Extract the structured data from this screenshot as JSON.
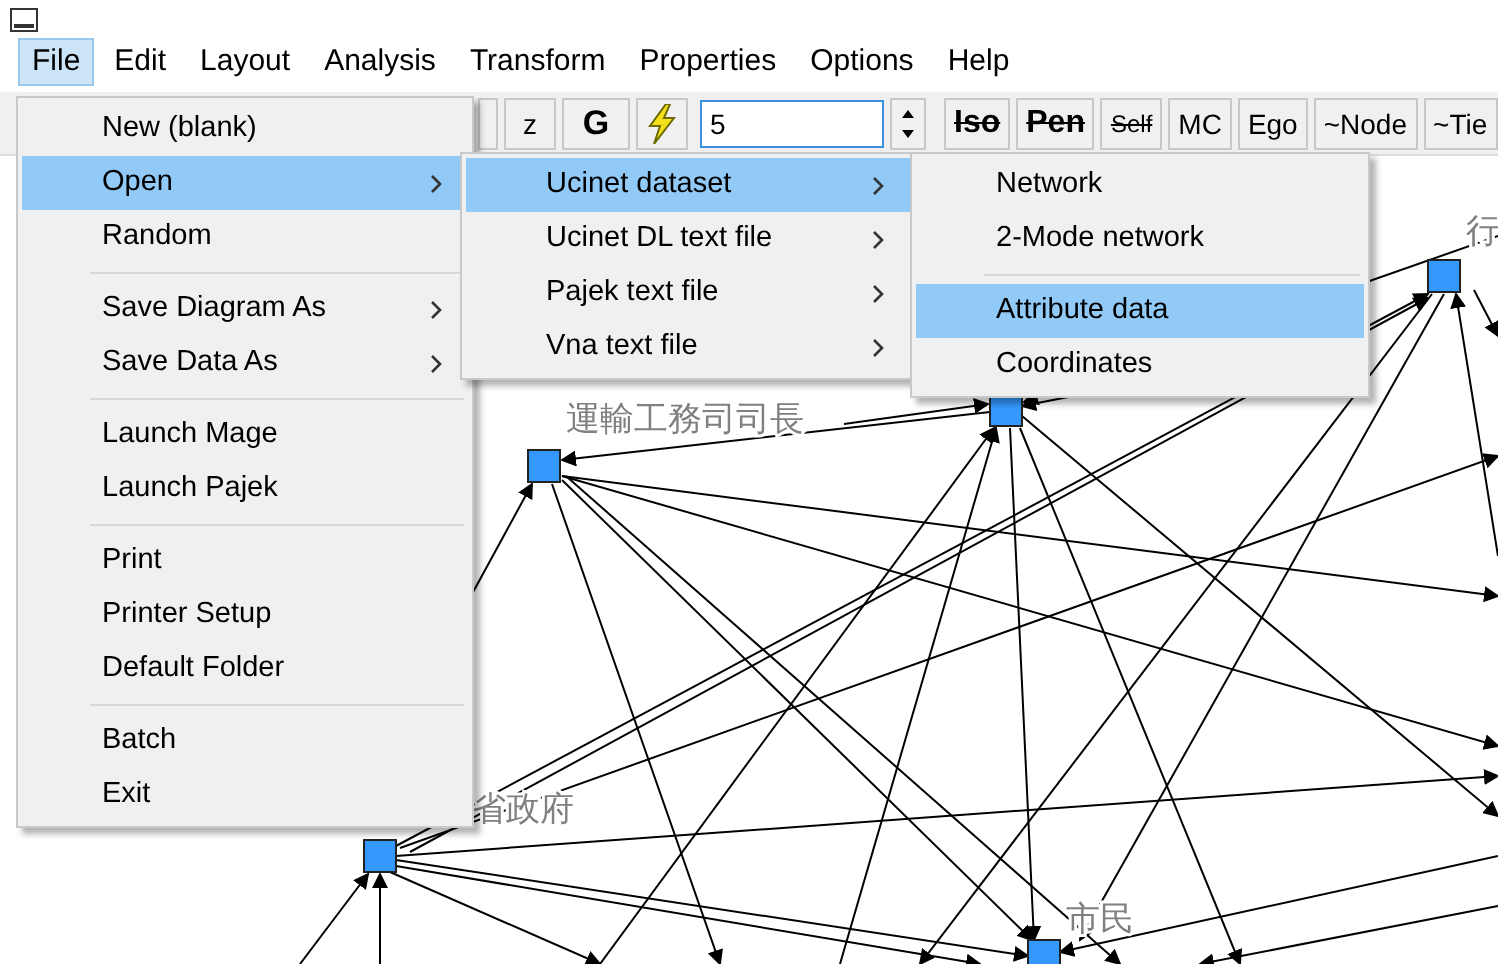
{
  "menubar": [
    {
      "label": "File",
      "selected": true
    },
    {
      "label": "Edit",
      "selected": false
    },
    {
      "label": "Layout",
      "selected": false
    },
    {
      "label": "Analysis",
      "selected": false
    },
    {
      "label": "Transform",
      "selected": false
    },
    {
      "label": "Properties",
      "selected": false
    },
    {
      "label": "Options",
      "selected": false
    },
    {
      "label": "Help",
      "selected": false
    }
  ],
  "toolbar": {
    "buttons": [
      {
        "kind": "text",
        "label": "z",
        "bold": false,
        "struck": false
      },
      {
        "kind": "text",
        "label": "G",
        "bold": true,
        "struck": false
      },
      {
        "kind": "lightning"
      }
    ],
    "field": {
      "value": "5"
    },
    "toggles": [
      {
        "label": "Iso",
        "bold": true,
        "struck": true
      },
      {
        "label": "Pen",
        "bold": true,
        "struck": true
      },
      {
        "label": "Self",
        "bold": false,
        "struck": true
      },
      {
        "label": "MC",
        "bold": false,
        "struck": false
      },
      {
        "label": "Ego",
        "bold": false,
        "struck": false
      },
      {
        "label": "~Node",
        "bold": false,
        "struck": false
      },
      {
        "label": "~Tie",
        "bold": false,
        "struck": false
      }
    ]
  },
  "file_menu": [
    {
      "kind": "item",
      "label": "New (blank)",
      "submenu": false,
      "selected": false
    },
    {
      "kind": "item",
      "label": "Open",
      "submenu": true,
      "selected": true
    },
    {
      "kind": "item",
      "label": "Random",
      "submenu": false,
      "selected": false
    },
    {
      "kind": "separator"
    },
    {
      "kind": "item",
      "label": "Save Diagram As",
      "submenu": true,
      "selected": false
    },
    {
      "kind": "item",
      "label": "Save Data As",
      "submenu": true,
      "selected": false
    },
    {
      "kind": "separator"
    },
    {
      "kind": "item",
      "label": "Launch Mage",
      "submenu": false,
      "selected": false
    },
    {
      "kind": "item",
      "label": "Launch Pajek",
      "submenu": false,
      "selected": false
    },
    {
      "kind": "separator"
    },
    {
      "kind": "item",
      "label": "Print",
      "submenu": false,
      "selected": false
    },
    {
      "kind": "item",
      "label": "Printer Setup",
      "submenu": false,
      "selected": false
    },
    {
      "kind": "item",
      "label": "Default Folder",
      "submenu": false,
      "selected": false
    },
    {
      "kind": "separator"
    },
    {
      "kind": "item",
      "label": "Batch",
      "submenu": false,
      "selected": false
    },
    {
      "kind": "item",
      "label": "Exit",
      "submenu": false,
      "selected": false
    }
  ],
  "open_menu": [
    {
      "kind": "item",
      "label": "Ucinet dataset",
      "submenu": true,
      "selected": true
    },
    {
      "kind": "item",
      "label": "Ucinet DL text file",
      "submenu": true,
      "selected": false
    },
    {
      "kind": "item",
      "label": "Pajek text file",
      "submenu": true,
      "selected": false
    },
    {
      "kind": "item",
      "label": "Vna text file",
      "submenu": true,
      "selected": false
    }
  ],
  "ucinet_menu": [
    {
      "kind": "item",
      "label": "Network",
      "submenu": false,
      "selected": false
    },
    {
      "kind": "item",
      "label": "2-Mode network",
      "submenu": false,
      "selected": false
    },
    {
      "kind": "separator"
    },
    {
      "kind": "item",
      "label": "Attribute data",
      "submenu": false,
      "selected": true
    },
    {
      "kind": "item",
      "label": "Coordinates",
      "submenu": false,
      "selected": false
    }
  ],
  "graph": {
    "nodes": [
      {
        "kind": "square",
        "label": "運輸工務司司長"
      },
      {
        "kind": "square"
      },
      {
        "kind": "square",
        "label": "行"
      },
      {
        "kind": "square",
        "label": "省政府"
      },
      {
        "kind": "square",
        "label": "市民"
      }
    ]
  }
}
